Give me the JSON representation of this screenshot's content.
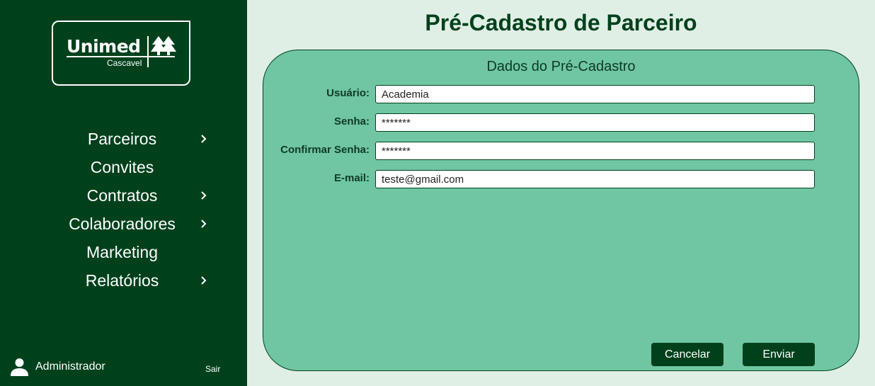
{
  "sidebar": {
    "logo": {
      "brand": "Unimed",
      "subtitle": "Cascavel"
    },
    "nav": [
      {
        "label": "Parceiros",
        "has_submenu": true,
        "icon": "chevron-right-icon"
      },
      {
        "label": "Convites",
        "has_submenu": false
      },
      {
        "label": "Contratos",
        "has_submenu": true,
        "icon": "chevron-right-icon"
      },
      {
        "label": "Colaboradores",
        "has_submenu": true,
        "icon": "chevron-right-icon"
      },
      {
        "label": "Marketing",
        "has_submenu": false
      },
      {
        "label": "Relatórios",
        "has_submenu": true,
        "icon": "chevron-right-icon"
      }
    ],
    "user": {
      "name": "Administrador",
      "icon": "user-icon",
      "logout_label": "Sair"
    }
  },
  "main": {
    "title": "Pré-Cadastro de Parceiro",
    "form": {
      "title": "Dados do Pré-Cadastro",
      "fields": [
        {
          "label": "Usuário:",
          "value": "Academia",
          "type": "text"
        },
        {
          "label": "Senha:",
          "value": "*******",
          "type": "text"
        },
        {
          "label": "Confirmar Senha:",
          "value": "*******",
          "type": "text"
        },
        {
          "label": "E-mail:",
          "value": "teste@gmail.com",
          "type": "text"
        }
      ],
      "cancel_label": "Cancelar",
      "submit_label": "Enviar"
    }
  },
  "colors": {
    "sidebar_bg": "#00411c",
    "page_bg": "#e0efe6",
    "card_bg": "#70c6a2",
    "accent": "#00411c"
  }
}
